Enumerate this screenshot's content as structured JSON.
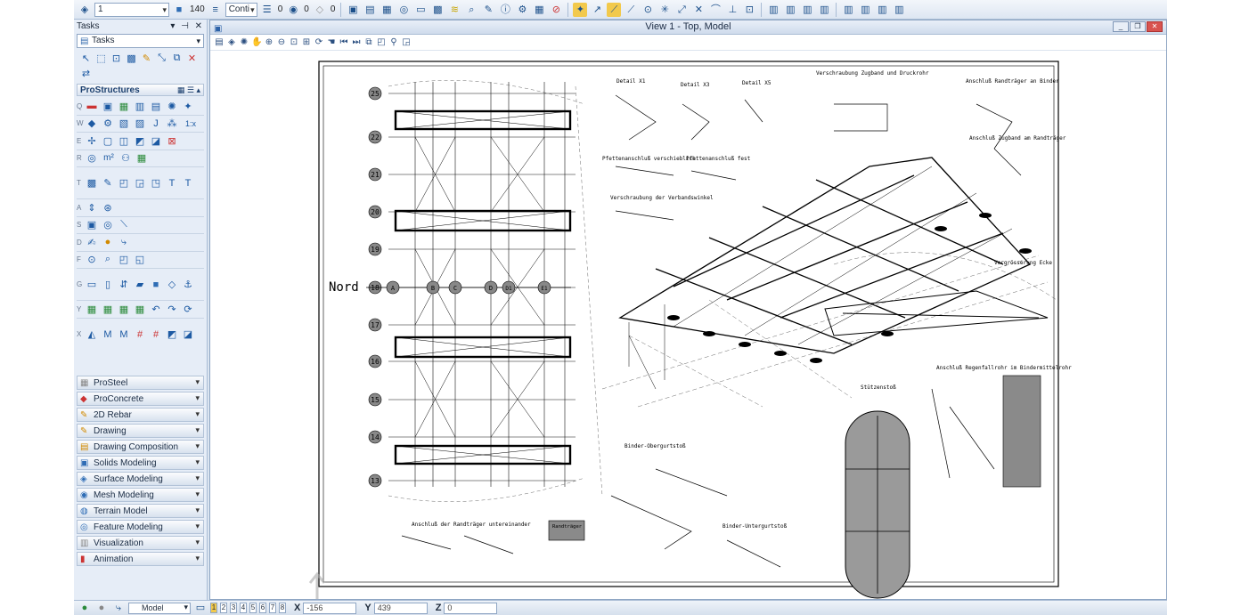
{
  "toolbar": {
    "level_value": "1",
    "weight_value": "140",
    "line_style_value": "Conti",
    "weight_num": "0",
    "color_num": "0",
    "transparency_num": "0"
  },
  "tasks": {
    "header": "Tasks",
    "select_value": "Tasks",
    "prostructures_label": "ProStructures",
    "row_letters": [
      "Q",
      "W",
      "E",
      "R",
      "T",
      "A",
      "S",
      "D",
      "F",
      "G",
      "Y",
      "X"
    ],
    "row_labels": {
      "two_d": "2D",
      "one_x": "1:x",
      "m2": "m²"
    },
    "categories": [
      {
        "label": "ProSteel",
        "icon": "prosteel-icon"
      },
      {
        "label": "ProConcrete",
        "icon": "proconcrete-icon"
      },
      {
        "label": "2D Rebar",
        "icon": "rebar-icon"
      },
      {
        "label": "Drawing",
        "icon": "drawing-icon"
      },
      {
        "label": "Drawing Composition",
        "icon": "composition-icon"
      },
      {
        "label": "Solids Modeling",
        "icon": "solids-icon"
      },
      {
        "label": "Surface Modeling",
        "icon": "surface-icon"
      },
      {
        "label": "Mesh Modeling",
        "icon": "mesh-icon"
      },
      {
        "label": "Terrain Model",
        "icon": "terrain-icon"
      },
      {
        "label": "Feature Modeling",
        "icon": "feature-icon"
      },
      {
        "label": "Visualization",
        "icon": "visualization-icon"
      },
      {
        "label": "Animation",
        "icon": "animation-icon"
      }
    ]
  },
  "view": {
    "title": "View 1 - Top, Model"
  },
  "drawing": {
    "nord_label": "Nord",
    "axis_numbers": [
      "25",
      "22",
      "21",
      "20",
      "19",
      "18",
      "17",
      "16",
      "15",
      "14",
      "13"
    ],
    "axis_letters": [
      "A",
      "B",
      "C",
      "D",
      "D1",
      "E1"
    ],
    "labels": {
      "verschraubung_zugband": "Verschraubung Zugband und Druckrohr",
      "anschluss_randtraeger": "Anschluß Randträger an Binder",
      "anschluss_zugband": "Anschluß Zugband am Randträger",
      "pfetten_verschieblich": "Pfettenanschluß verschieblich",
      "pfetten_fest": "Pfettenanschluß fest",
      "verschraubung_verband": "Verschraubung der Verbandswinkel",
      "vergroesserung": "Vergrösserung Ecke",
      "regenfallrohr": "Anschluß Regenfallrohr im Bindermittelrohr",
      "stuetzenstoss": "Stützenstoß",
      "binder_ober": "Binder-Obergurtstoß",
      "binder_unter": "Binder-Untergurtstoß",
      "randtraeger_unter": "Anschluß der Randträger untereinander",
      "randtraeger_legend": "Randträger",
      "detail_x1": "Detail X1",
      "detail_x3": "Detail X3",
      "detail_x5": "Detail X5"
    }
  },
  "status": {
    "model_value": "Model",
    "views": [
      "1",
      "2",
      "3",
      "4",
      "5",
      "6",
      "7",
      "8"
    ],
    "x_label": "X",
    "x_value": "-156",
    "y_label": "Y",
    "y_value": "439",
    "z_label": "Z",
    "z_value": "0"
  }
}
